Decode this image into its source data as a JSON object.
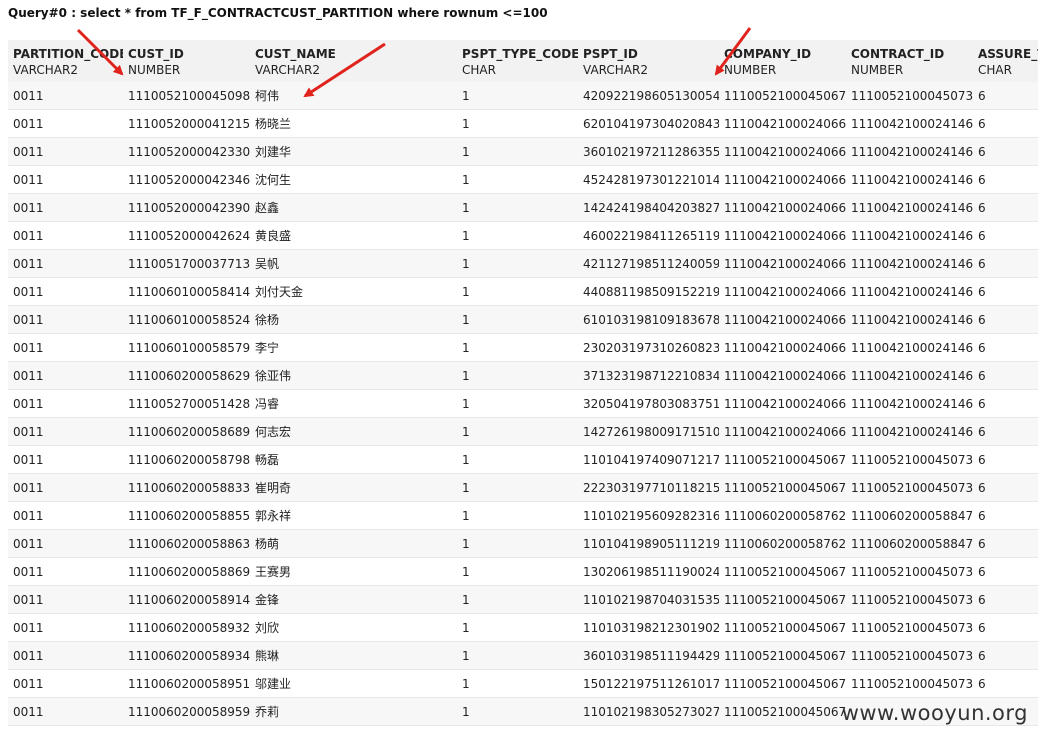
{
  "query": {
    "text": "Query#0 : select * from TF_F_CONTRACTCUST_PARTITION where rownum <=100"
  },
  "columns": [
    {
      "name": "PARTITION_CODE",
      "type": "VARCHAR2"
    },
    {
      "name": "CUST_ID",
      "type": "NUMBER"
    },
    {
      "name": "CUST_NAME",
      "type": "VARCHAR2"
    },
    {
      "name": "PSPT_TYPE_CODE",
      "type": "CHAR"
    },
    {
      "name": "PSPT_ID",
      "type": "VARCHAR2"
    },
    {
      "name": "COMPANY_ID",
      "type": "NUMBER"
    },
    {
      "name": "CONTRACT_ID",
      "type": "NUMBER"
    },
    {
      "name": "ASSURE_TYPE",
      "type": "CHAR"
    }
  ],
  "rows": [
    [
      "0011",
      "1110052100045098",
      "柯伟",
      "1",
      "420922198605130054",
      "1110052100045067",
      "1110052100045073",
      "6"
    ],
    [
      "0011",
      "1110052000041215",
      "杨晓兰",
      "1",
      "620104197304020843",
      "1110042100024066",
      "1110042100024146",
      "6"
    ],
    [
      "0011",
      "1110052000042330",
      "刘建华",
      "1",
      "360102197211286355",
      "1110042100024066",
      "1110042100024146",
      "6"
    ],
    [
      "0011",
      "1110052000042346",
      "沈何生",
      "1",
      "452428197301221014",
      "1110042100024066",
      "1110042100024146",
      "6"
    ],
    [
      "0011",
      "1110052000042390",
      "赵鑫",
      "1",
      "142424198404203827",
      "1110042100024066",
      "1110042100024146",
      "6"
    ],
    [
      "0011",
      "1110052000042624",
      "黄良盛",
      "1",
      "460022198411265119",
      "1110042100024066",
      "1110042100024146",
      "6"
    ],
    [
      "0011",
      "1110051700037713",
      "吴帆",
      "1",
      "421127198511240059",
      "1110042100024066",
      "1110042100024146",
      "6"
    ],
    [
      "0011",
      "1110060100058414",
      "刘付天金",
      "1",
      "440881198509152219",
      "1110042100024066",
      "1110042100024146",
      "6"
    ],
    [
      "0011",
      "1110060100058524",
      "徐杨",
      "1",
      "610103198109183678",
      "1110042100024066",
      "1110042100024146",
      "6"
    ],
    [
      "0011",
      "1110060100058579",
      "李宁",
      "1",
      "230203197310260823",
      "1110042100024066",
      "1110042100024146",
      "6"
    ],
    [
      "0011",
      "1110060200058629",
      "徐亚伟",
      "1",
      "371323198712210834",
      "1110042100024066",
      "1110042100024146",
      "6"
    ],
    [
      "0011",
      "1110052700051428",
      "冯睿",
      "1",
      "320504197803083751",
      "1110042100024066",
      "1110042100024146",
      "6"
    ],
    [
      "0011",
      "1110060200058689",
      "何志宏",
      "1",
      "142726198009171510",
      "1110042100024066",
      "1110042100024146",
      "6"
    ],
    [
      "0011",
      "1110060200058798",
      "畅磊",
      "1",
      "110104197409071217",
      "1110052100045067",
      "1110052100045073",
      "6"
    ],
    [
      "0011",
      "1110060200058833",
      "崔明奇",
      "1",
      "222303197710118215",
      "1110052100045067",
      "1110052100045073",
      "6"
    ],
    [
      "0011",
      "1110060200058855",
      "郭永祥",
      "1",
      "110102195609282316",
      "1110060200058762",
      "1110060200058847",
      "6"
    ],
    [
      "0011",
      "1110060200058863",
      "杨萌",
      "1",
      "110104198905111219",
      "1110060200058762",
      "1110060200058847",
      "6"
    ],
    [
      "0011",
      "1110060200058869",
      "王赛男",
      "1",
      "130206198511190024",
      "1110052100045067",
      "1110052100045073",
      "6"
    ],
    [
      "0011",
      "1110060200058914",
      "金锋",
      "1",
      "110102198704031535",
      "1110052100045067",
      "1110052100045073",
      "6"
    ],
    [
      "0011",
      "1110060200058932",
      "刘欣",
      "1",
      "110103198212301902",
      "1110052100045067",
      "1110052100045073",
      "6"
    ],
    [
      "0011",
      "1110060200058934",
      "熊琳",
      "1",
      "360103198511194429",
      "1110052100045067",
      "1110052100045073",
      "6"
    ],
    [
      "0011",
      "1110060200058951",
      "邬建业",
      "1",
      "150122197511261017",
      "1110052100045067",
      "1110052100045073",
      "6"
    ],
    [
      "0011",
      "1110060200058959",
      "乔莉",
      "1",
      "110102198305273027",
      "1110052100045067",
      "",
      ""
    ]
  ],
  "watermark": {
    "text": "www.wooyun.org"
  },
  "colors": {
    "header_bg": "#f2f2f2",
    "arrow": "#e0231c"
  }
}
